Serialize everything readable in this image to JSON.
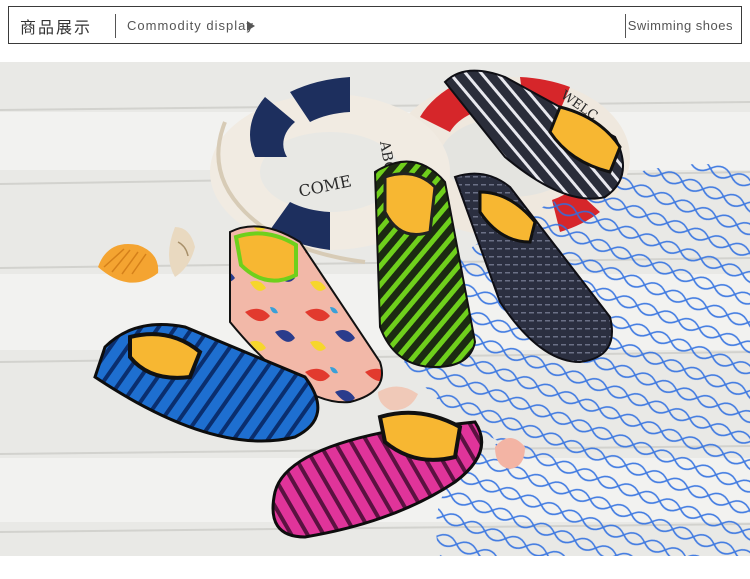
{
  "header": {
    "title_cn": "商品展示",
    "title_en": "Commodity display",
    "category": "Swimming shoes"
  },
  "ring_text": {
    "left": "COME",
    "middle": "ABO",
    "right": "WELC"
  },
  "product_image": {
    "colors": {
      "blue_shoe": "#1e6fd0",
      "pink_shoe": "#e0349a",
      "green_shoe": "#5fc41a",
      "dark_shoe": "#2a2d3a",
      "navy_gray_shoe": "#3b3f52",
      "insole": "#f7b732",
      "net": "#2f6fe0",
      "ring_red": "#d6262a",
      "ring_navy": "#1d2f5e",
      "planks": "#eeeeec"
    }
  }
}
